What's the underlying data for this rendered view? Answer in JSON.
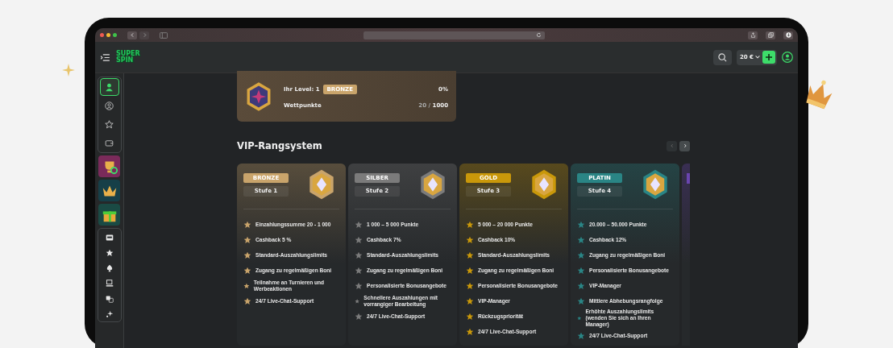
{
  "header": {
    "logo": "SUPER SPIN",
    "balance": "20 €"
  },
  "sidebar": {
    "items": [
      {
        "kind": "user",
        "selected": true
      },
      {
        "kind": "account",
        "selected": false
      },
      {
        "kind": "star",
        "selected": false
      },
      {
        "kind": "wallet",
        "selected": false
      }
    ],
    "tiles": [
      {
        "kind": "trophy",
        "color": "#7a2a5a"
      },
      {
        "kind": "crown",
        "color": "#163f48"
      },
      {
        "kind": "gift",
        "color": "#1a4a44"
      }
    ],
    "games": [
      {
        "kind": "slot"
      },
      {
        "kind": "star"
      },
      {
        "kind": "spade"
      },
      {
        "kind": "screen"
      },
      {
        "kind": "dice"
      },
      {
        "kind": "sparkle"
      }
    ]
  },
  "level_card": {
    "level_label": "Ihr Level: 1",
    "rank": "BRONZE",
    "percent": "0%",
    "points_label": "Wettpunkte",
    "points": "20 /",
    "points_max": "1000"
  },
  "heading": "VIP-Rangsystem",
  "tiers": [
    {
      "name": "BRONZE",
      "stage": "Stufe 1",
      "color": "#c9a46b",
      "benefits": [
        "Einzahlungssumme 20 - 1 000",
        "Cashback 5 %",
        "Standard-Auszahlungslimits",
        "Zugang zu regelmäßigen Boni",
        "Teilnahme an Turnieren und Werbeaktionen",
        "24/7 Live-Chat-Support"
      ]
    },
    {
      "name": "SILBER",
      "stage": "Stufe 2",
      "color": "#7b7b7b",
      "benefits": [
        "1 000 – 5 000 Punkte",
        "Cashback 7%",
        "Standard-Auszahlungslimits",
        "Zugang zu regelmäßigen Boni",
        "Personalisierte Bonusangebote",
        "Schnellere Auszahlungen mit vorrangiger Bearbeitung",
        "24/7 Live-Chat-Support"
      ]
    },
    {
      "name": "GOLD",
      "stage": "Stufe 3",
      "color": "#c9980a",
      "benefits": [
        "5 000 – 20 000 Punkte",
        "Cashback 10%",
        "Standard-Auszahlungslimits",
        "Zugang zu regelmäßigen Boni",
        "Personalisierte Bonusangebote",
        "VIP-Manager",
        "Rückzugspriorität",
        "24/7 Live-Chat-Support"
      ]
    },
    {
      "name": "PLATIN",
      "stage": "Stufe 4",
      "color": "#2a8585",
      "benefits": [
        "20.000 – 50.000 Punkte",
        "Cashback 12%",
        "Zugang zu regelmäßigen Boni",
        "Personalisierte Bonusangebote",
        "VIP-Manager",
        "Mittlere Abhebungsrangfolge",
        "Erhöhte Auszahlungslimits (wenden Sie sich an Ihren Manager)",
        "24/7 Live-Chat-Support"
      ]
    },
    {
      "color": "#6a45b0"
    }
  ]
}
